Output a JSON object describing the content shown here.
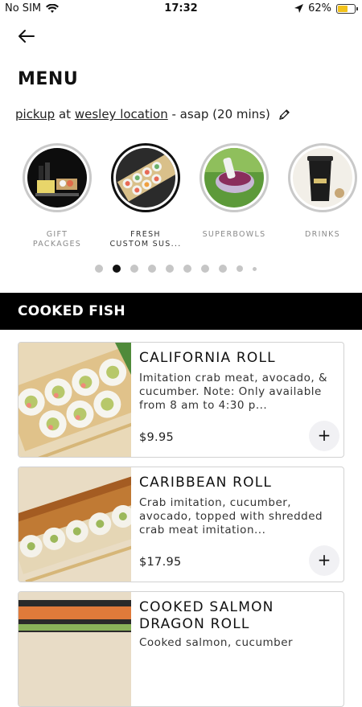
{
  "status": {
    "carrier": "No SIM",
    "time": "17:32",
    "battery": "62%",
    "battery_level": 0.62
  },
  "header": {
    "title": "MENU"
  },
  "order": {
    "mode": "pickup",
    "at": "at",
    "location": "wesley location",
    "timing": "- asap (20 mins)"
  },
  "categories": [
    {
      "label": "GIFT PACKAGES"
    },
    {
      "label": "FRESH CUSTOM SUS..."
    },
    {
      "label": "SUPERBOWLS"
    },
    {
      "label": "DRINKS"
    }
  ],
  "carousel": {
    "active_index": 1,
    "count": 10
  },
  "section": {
    "title": "COOKED FISH"
  },
  "items": [
    {
      "name": "CALIFORNIA ROLL",
      "description": "Imitation crab meat, avocado, & cucumber. Note: Only available from 8 am to 4:30 p...",
      "price": "$9.95",
      "add_label": "+"
    },
    {
      "name": "CARIBBEAN ROLL",
      "description": "Crab imitation, cucumber, avocado, topped with shredded crab meat imitation...",
      "price": "$17.95",
      "add_label": "+"
    },
    {
      "name": "COOKED SALMON DRAGON ROLL",
      "description": "Cooked salmon, cucumber",
      "price": "",
      "add_label": "+"
    }
  ]
}
